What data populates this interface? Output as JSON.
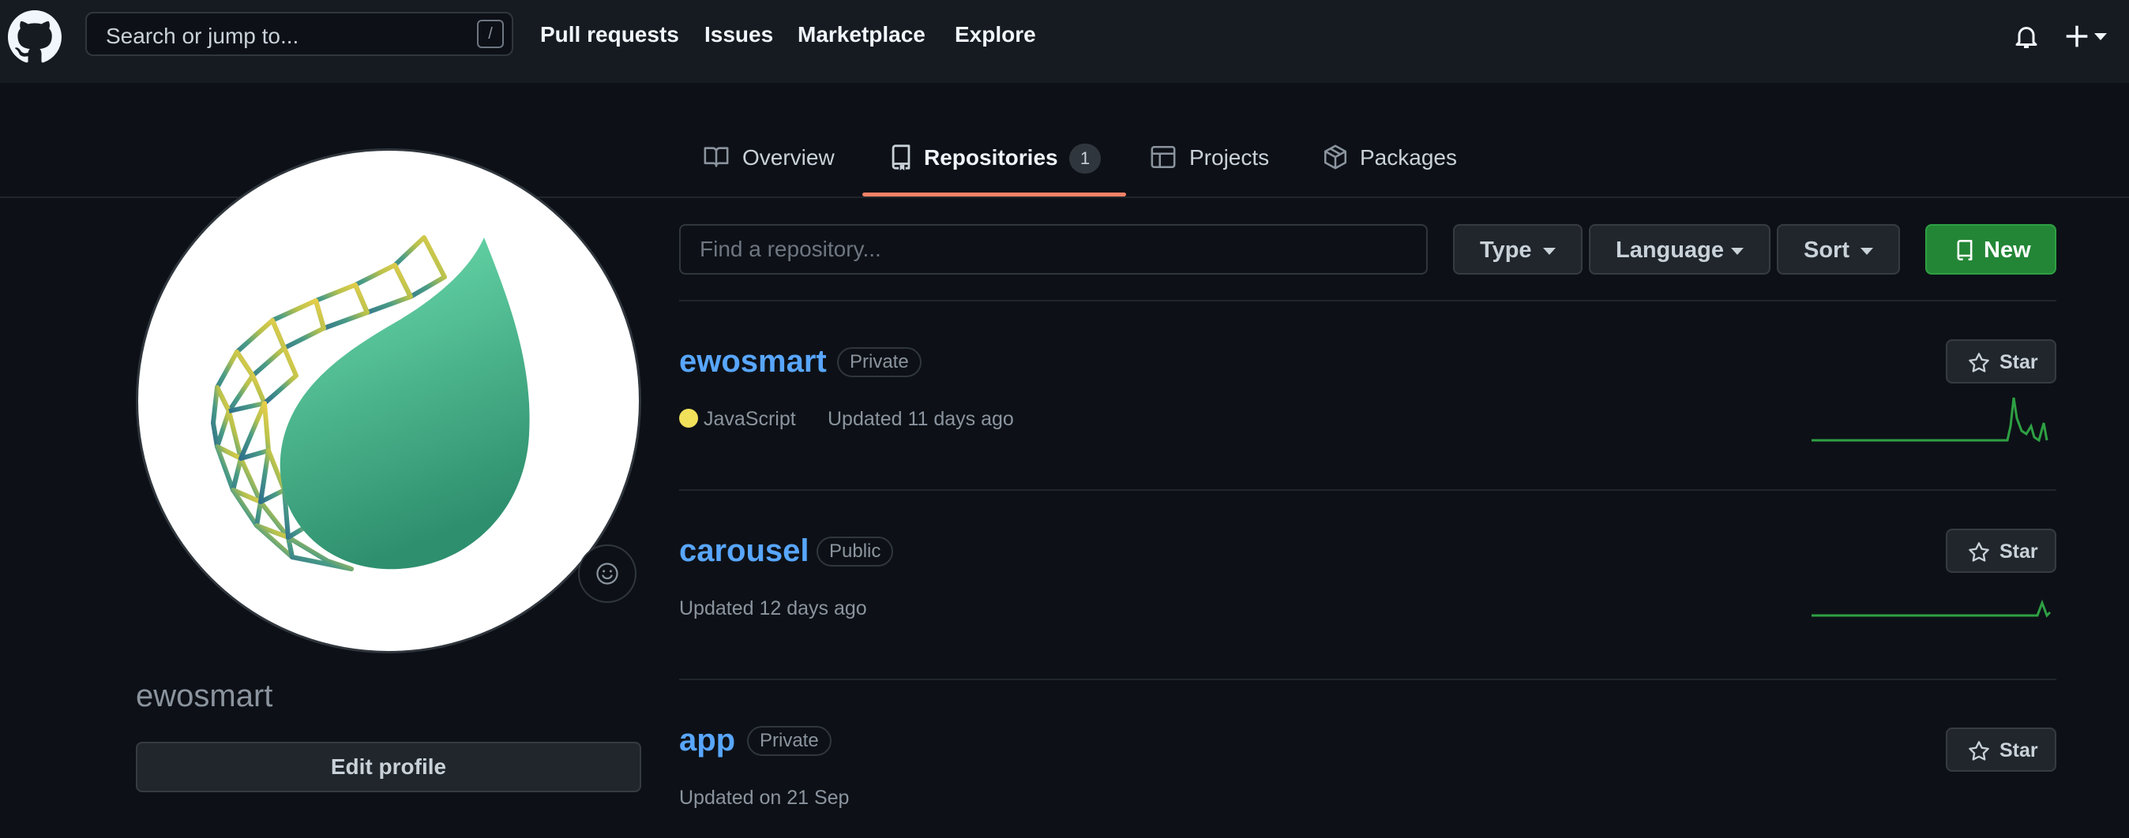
{
  "header": {
    "search_placeholder": "Search or jump to...",
    "search_shortcut": "/",
    "nav": [
      "Pull requests",
      "Issues",
      "Marketplace",
      "Explore"
    ]
  },
  "tabs": [
    {
      "label": "Overview",
      "icon": "book-icon"
    },
    {
      "label": "Repositories",
      "icon": "repo-icon",
      "count": "1",
      "active": true
    },
    {
      "label": "Projects",
      "icon": "table-icon"
    },
    {
      "label": "Packages",
      "icon": "package-icon"
    }
  ],
  "profile": {
    "username": "ewosmart",
    "edit_label": "Edit profile"
  },
  "toolbar": {
    "find_placeholder": "Find a repository...",
    "type_label": "Type",
    "language_label": "Language",
    "sort_label": "Sort",
    "new_label": "New"
  },
  "repos": [
    {
      "name": "ewosmart",
      "visibility": "Private",
      "language": "JavaScript",
      "language_color": "#f1e05a",
      "updated": "Updated 11 days ago",
      "star_label": "Star"
    },
    {
      "name": "carousel",
      "visibility": "Public",
      "updated": "Updated 12 days ago",
      "star_label": "Star"
    },
    {
      "name": "app",
      "visibility": "Private",
      "updated": "Updated on 21 Sep",
      "star_label": "Star"
    }
  ],
  "colors": {
    "accent_link": "#58a6ff",
    "tab_underline": "#f78166",
    "new_button": "#238636",
    "sparkline": "#2ea043"
  }
}
